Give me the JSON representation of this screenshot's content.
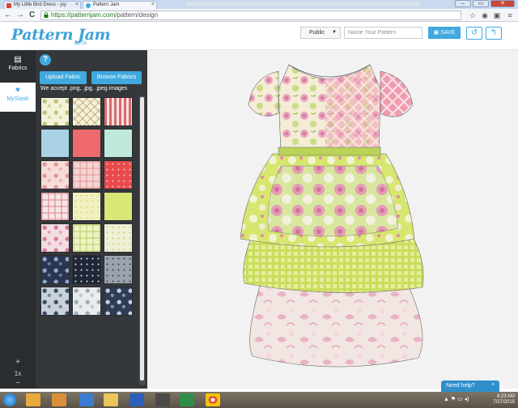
{
  "browser": {
    "tabs": [
      {
        "label": "My Little Bird Dress - joy",
        "icon": "gmail-icon"
      },
      {
        "label": "Pattern Jam",
        "icon": "patternjam-icon"
      }
    ],
    "url_scheme": "https://",
    "url_host": "patternjam.com",
    "url_path": "/pattern/design",
    "window_controls": [
      "–",
      "▭",
      "✕"
    ],
    "nav": {
      "back": "←",
      "forward": "→",
      "reload": "C"
    }
  },
  "header": {
    "logo": "Pattern Jam",
    "logo_badge": "BETA",
    "visibility_select": "Public",
    "pattern_name_placeholder": "Name Your Pattern",
    "save_label": "SAVE"
  },
  "leftnav": {
    "items": [
      {
        "label": "Fabrics",
        "icon": "fabrics-icon"
      },
      {
        "label": "MyStash",
        "icon": "heart-icon"
      }
    ],
    "zoom_in": "+",
    "zoom_level": "1x",
    "zoom_out": "−"
  },
  "panel": {
    "help": "?",
    "upload_label": "Upload Fabric",
    "browse_label": "Browse Fabrics",
    "accept_text": "We accept .png, .jpg, .jpeg images"
  },
  "colors": {
    "accent": "#3fa9e0",
    "sidebar": "#2a2d30",
    "panel": "#35383b"
  },
  "swatches": [
    {
      "bg": "#f5f1d8",
      "fg": "#b9c77a",
      "pattern": "floral"
    },
    {
      "bg": "#f3f0da",
      "fg": "#c7b37a",
      "pattern": "lattice"
    },
    {
      "bg": "#f6e4de",
      "fg": "#d96a6f",
      "pattern": "stripes"
    },
    {
      "bg": "#a9d3e4",
      "fg": "#a9d3e4",
      "pattern": "solid"
    },
    {
      "bg": "#ee6a6c",
      "fg": "#ee6a6c",
      "pattern": "solid"
    },
    {
      "bg": "#bfe8da",
      "fg": "#bfe8da",
      "pattern": "solid"
    },
    {
      "bg": "#f7dcd8",
      "fg": "#e29a9c",
      "pattern": "floral"
    },
    {
      "bg": "#f3d6d3",
      "fg": "#e78e92",
      "pattern": "plaid"
    },
    {
      "bg": "#e94a4e",
      "fg": "#f6c2c2",
      "pattern": "dots"
    },
    {
      "bg": "#f4e6e6",
      "fg": "#e07f86",
      "pattern": "plaid"
    },
    {
      "bg": "#f1f1c0",
      "fg": "#dada79",
      "pattern": "dots"
    },
    {
      "bg": "#d9e776",
      "fg": "#c4d456",
      "pattern": "solid"
    },
    {
      "bg": "#f2dde3",
      "fg": "#d97d94",
      "pattern": "floral"
    },
    {
      "bg": "#eef2c6",
      "fg": "#b8cf5d",
      "pattern": "plaid"
    },
    {
      "bg": "#f0f0d8",
      "fg": "#c2d47a",
      "pattern": "dots"
    },
    {
      "bg": "#2a3550",
      "fg": "#8fa6cf",
      "pattern": "floral"
    },
    {
      "bg": "#1f2636",
      "fg": "#cfd6e6",
      "pattern": "dots"
    },
    {
      "bg": "#9ba4ad",
      "fg": "#3c4755",
      "pattern": "dots"
    },
    {
      "bg": "#c9d2dc",
      "fg": "#3e4e64",
      "pattern": "floral"
    },
    {
      "bg": "#e8ecef",
      "fg": "#a2acb6",
      "pattern": "floral"
    },
    {
      "bg": "#2e3c54",
      "fg": "#c3cee0",
      "pattern": "floral"
    }
  ],
  "help_tab": {
    "label": "Need help?",
    "arrow": "^"
  },
  "taskbar": {
    "time": "8:23 AM",
    "date": "7/27/2015"
  }
}
